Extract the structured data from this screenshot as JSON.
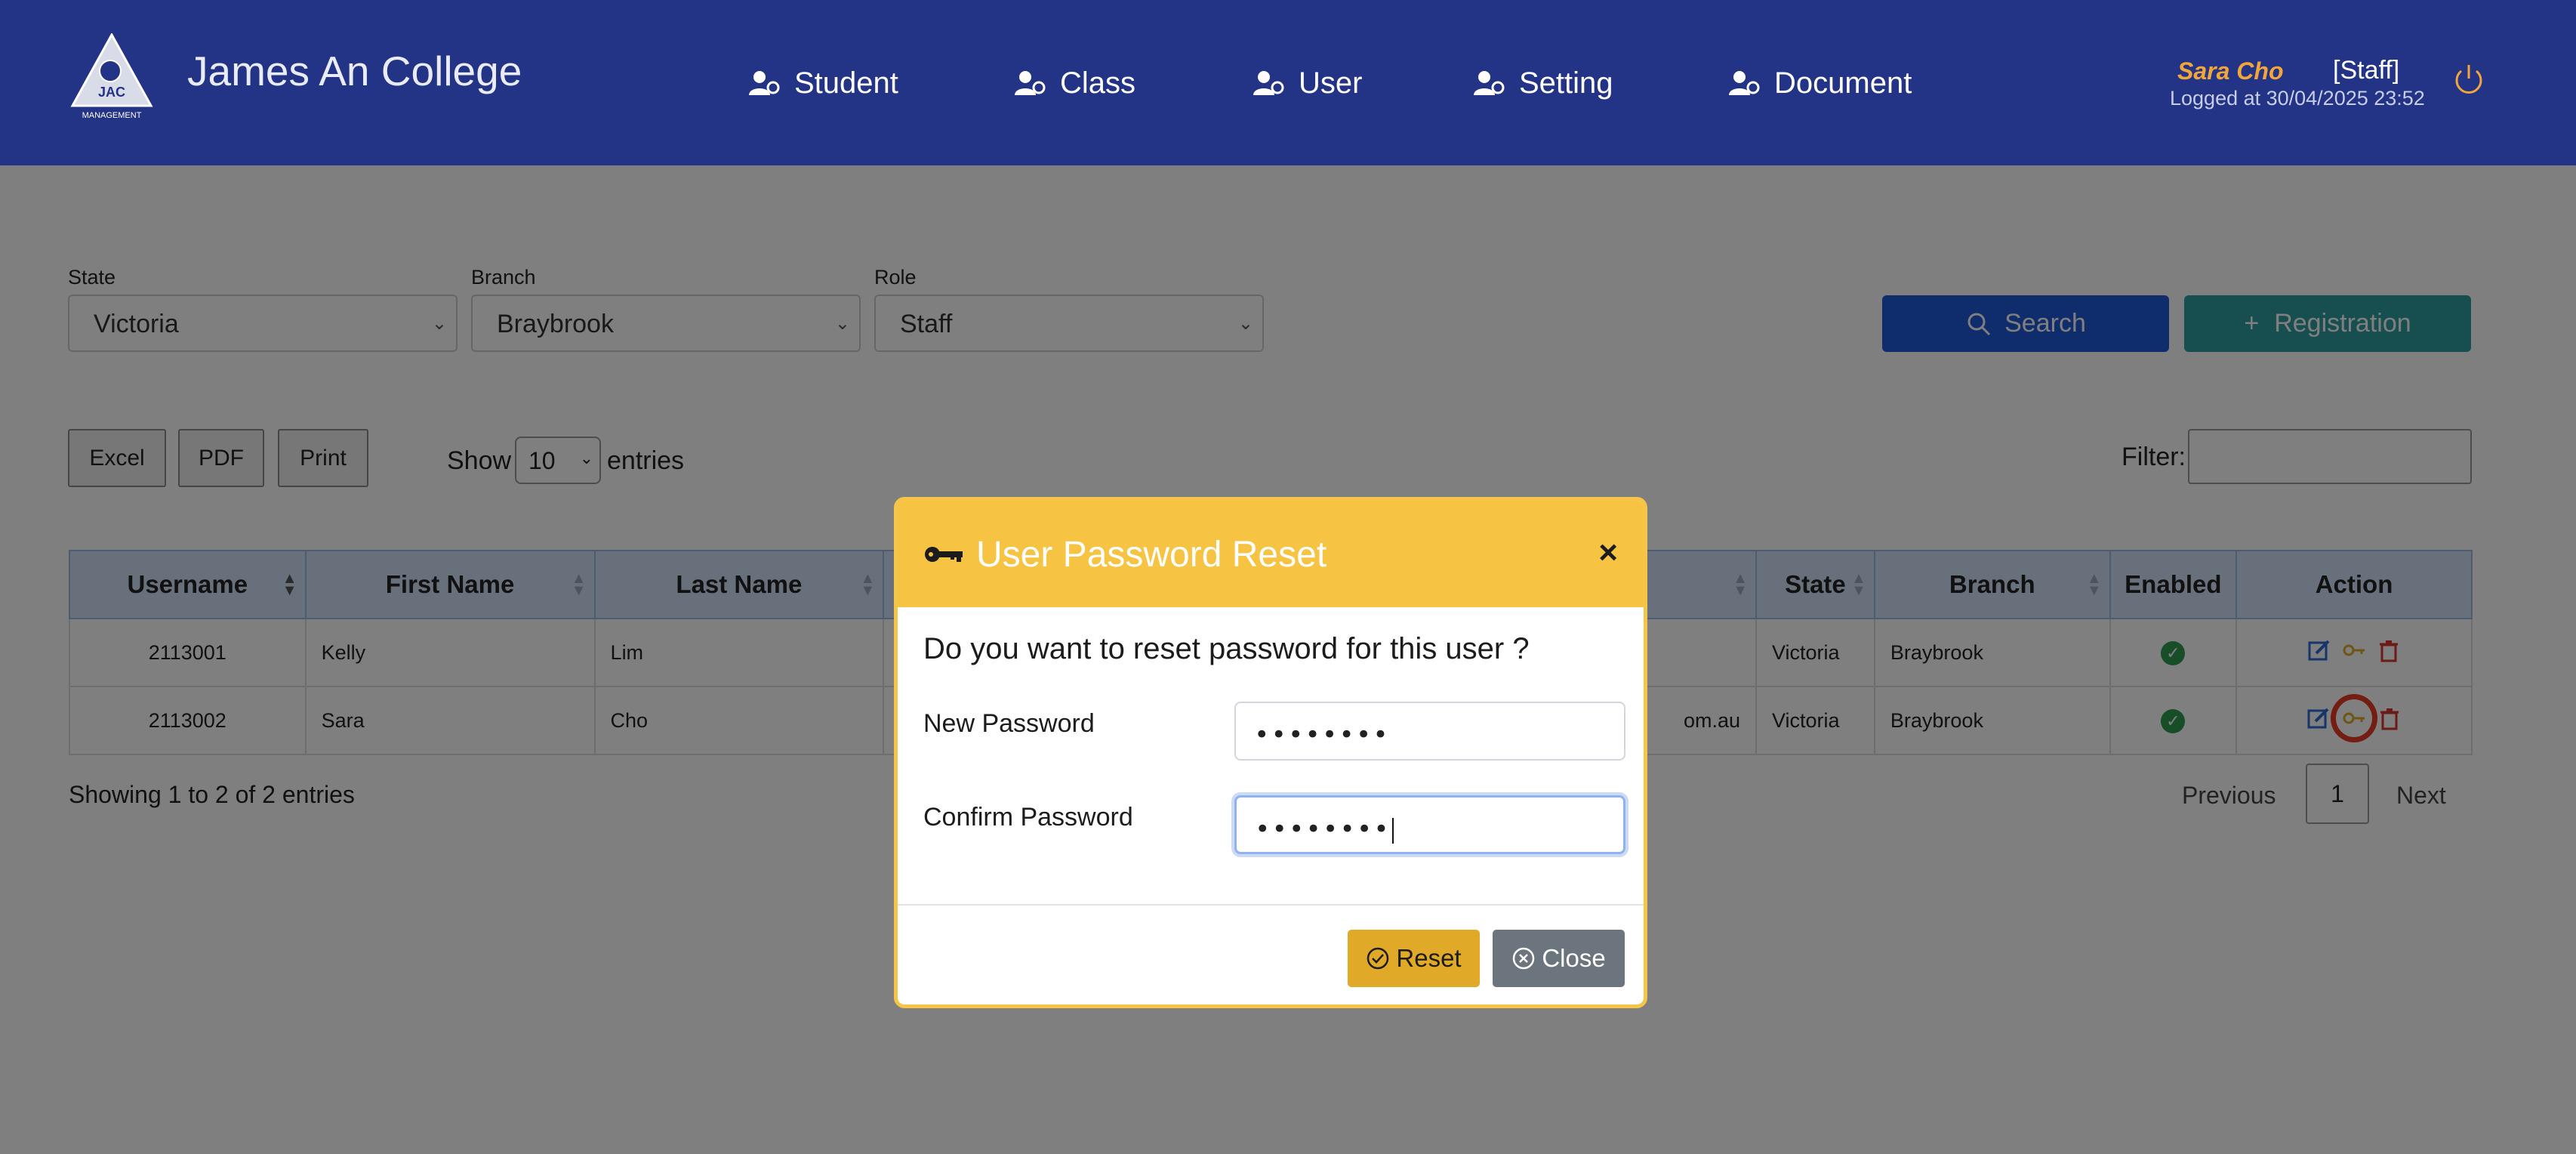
{
  "app": {
    "brand": "James An College",
    "logo_text": "JAC MANAGEMENT"
  },
  "nav": [
    {
      "label": "Student"
    },
    {
      "label": "Class"
    },
    {
      "label": "User"
    },
    {
      "label": "Setting"
    },
    {
      "label": "Document"
    }
  ],
  "user": {
    "name": "Sara Cho",
    "role": "[Staff]",
    "login": "Logged at 30/04/2025 23:52"
  },
  "filters": {
    "state": {
      "label": "State",
      "value": "Victoria"
    },
    "branch": {
      "label": "Branch",
      "value": "Braybrook"
    },
    "role": {
      "label": "Role",
      "value": "Staff"
    }
  },
  "actions": {
    "search": "Search",
    "registration": "Registration"
  },
  "toolbar": {
    "excel": "Excel",
    "pdf": "PDF",
    "print": "Print",
    "show": "Show",
    "entries_value": "10",
    "entries": "entries",
    "filter": "Filter:"
  },
  "table": {
    "headers": [
      "Username",
      "First Name",
      "Last Name",
      "",
      "State",
      "Branch",
      "Enabled",
      "Action"
    ],
    "rows": [
      {
        "username": "2113001",
        "first": "Kelly",
        "last": "Lim",
        "email": "",
        "state": "Victoria",
        "branch": "Braybrook"
      },
      {
        "username": "2113002",
        "first": "Sara",
        "last": "Cho",
        "email": "om.au",
        "state": "Victoria",
        "branch": "Braybrook"
      }
    ]
  },
  "footer": {
    "showing": "Showing 1 to 2 of 2 entries",
    "previous": "Previous",
    "page": "1",
    "next": "Next"
  },
  "modal": {
    "title": "User Password Reset",
    "close_x": "×",
    "question": "Do you want to reset password for this user ?",
    "new_password_label": "New Password",
    "new_password_value": "••••••••",
    "confirm_password_label": "Confirm Password",
    "confirm_password_value": "••••••••",
    "reset": "Reset",
    "close": "Close"
  },
  "colors": {
    "header_bg": "#233385",
    "accent_yellow": "#f6c343",
    "search_blue": "#1f58d8",
    "registration_teal": "#2f9ca0",
    "highlight_red": "#e63a26"
  }
}
